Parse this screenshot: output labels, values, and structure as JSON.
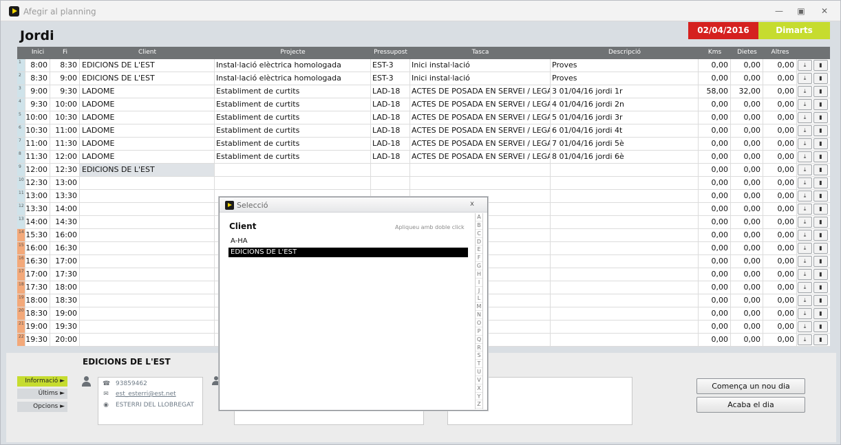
{
  "window": {
    "title": "Afegir al planning"
  },
  "header": {
    "user": "Jordi",
    "date": "02/04/2016",
    "weekday": "Dimarts"
  },
  "columns": [
    "Inici",
    "Fi",
    "Client",
    "Projecte",
    "Pressupost",
    "Tasca",
    "Descripció",
    "Kms",
    "Dietes",
    "Altres"
  ],
  "rows": [
    {
      "n": "1",
      "start": "8:00",
      "end": "8:30",
      "client": "EDICIONS DE L'EST",
      "project": "Instal·lació elèctrica homologada",
      "budget": "EST-3",
      "task": "Inici instal·lació",
      "desc": "Proves",
      "kms": "0,00",
      "dietes": "0,00",
      "altres": "0,00"
    },
    {
      "n": "2",
      "start": "8:30",
      "end": "9:00",
      "client": "EDICIONS DE L'EST",
      "project": "Instal·lació elèctrica homologada",
      "budget": "EST-3",
      "task": "Inici instal·lació",
      "desc": "Proves",
      "kms": "0,00",
      "dietes": "0,00",
      "altres": "0,00"
    },
    {
      "n": "3",
      "start": "9:00",
      "end": "9:30",
      "client": "LADOME",
      "project": "Establiment de curtits",
      "budget": "LAD-18",
      "task": "ACTES DE POSADA EN SERVEI / LEGALIT",
      "desc": "3 01/04/16 jordi 1r",
      "kms": "58,00",
      "dietes": "32,00",
      "altres": "0,00"
    },
    {
      "n": "4",
      "start": "9:30",
      "end": "10:00",
      "client": "LADOME",
      "project": "Establiment de curtits",
      "budget": "LAD-18",
      "task": "ACTES DE POSADA EN SERVEI / LEGALIT",
      "desc": "4 01/04/16 jordi 2n",
      "kms": "0,00",
      "dietes": "0,00",
      "altres": "0,00"
    },
    {
      "n": "5",
      "start": "10:00",
      "end": "10:30",
      "client": "LADOME",
      "project": "Establiment de curtits",
      "budget": "LAD-18",
      "task": "ACTES DE POSADA EN SERVEI / LEGALIT",
      "desc": "5 01/04/16 jordi 3r",
      "kms": "0,00",
      "dietes": "0,00",
      "altres": "0,00"
    },
    {
      "n": "6",
      "start": "10:30",
      "end": "11:00",
      "client": "LADOME",
      "project": "Establiment de curtits",
      "budget": "LAD-18",
      "task": "ACTES DE POSADA EN SERVEI / LEGALIT",
      "desc": "6 01/04/16 jordi 4t",
      "kms": "0,00",
      "dietes": "0,00",
      "altres": "0,00"
    },
    {
      "n": "7",
      "start": "11:00",
      "end": "11:30",
      "client": "LADOME",
      "project": "Establiment de curtits",
      "budget": "LAD-18",
      "task": "ACTES DE POSADA EN SERVEI / LEGALIT",
      "desc": "7 01/04/16 jordi 5è",
      "kms": "0,00",
      "dietes": "0,00",
      "altres": "0,00"
    },
    {
      "n": "8",
      "start": "11:30",
      "end": "12:00",
      "client": "LADOME",
      "project": "Establiment de curtits",
      "budget": "LAD-18",
      "task": "ACTES DE POSADA EN SERVEI / LEGALIT",
      "desc": "8 01/04/16 jordi 6è",
      "kms": "0,00",
      "dietes": "0,00",
      "altres": "0,00"
    },
    {
      "n": "9",
      "start": "12:00",
      "end": "12:30",
      "client": "EDICIONS DE L'EST",
      "project": "",
      "budget": "",
      "task": "",
      "desc": "",
      "kms": "0,00",
      "dietes": "0,00",
      "altres": "0,00",
      "selected": true
    },
    {
      "n": "10",
      "start": "12:30",
      "end": "13:00",
      "client": "",
      "project": "",
      "budget": "",
      "task": "",
      "desc": "",
      "kms": "0,00",
      "dietes": "0,00",
      "altres": "0,00"
    },
    {
      "n": "11",
      "start": "13:00",
      "end": "13:30",
      "client": "",
      "project": "",
      "budget": "",
      "task": "",
      "desc": "",
      "kms": "0,00",
      "dietes": "0,00",
      "altres": "0,00"
    },
    {
      "n": "12",
      "start": "13:30",
      "end": "14:00",
      "client": "",
      "project": "",
      "budget": "",
      "task": "",
      "desc": "",
      "kms": "0,00",
      "dietes": "0,00",
      "altres": "0,00"
    },
    {
      "n": "13",
      "start": "14:00",
      "end": "14:30",
      "client": "",
      "project": "",
      "budget": "",
      "task": "",
      "desc": "",
      "kms": "0,00",
      "dietes": "0,00",
      "altres": "0,00"
    },
    {
      "n": "14",
      "start": "15:30",
      "end": "16:00",
      "client": "",
      "project": "",
      "budget": "",
      "task": "",
      "desc": "",
      "kms": "0,00",
      "dietes": "0,00",
      "altres": "0,00",
      "afternoon": true
    },
    {
      "n": "15",
      "start": "16:00",
      "end": "16:30",
      "client": "",
      "project": "",
      "budget": "",
      "task": "",
      "desc": "",
      "kms": "0,00",
      "dietes": "0,00",
      "altres": "0,00",
      "afternoon": true
    },
    {
      "n": "16",
      "start": "16:30",
      "end": "17:00",
      "client": "",
      "project": "",
      "budget": "",
      "task": "",
      "desc": "",
      "kms": "0,00",
      "dietes": "0,00",
      "altres": "0,00",
      "afternoon": true
    },
    {
      "n": "17",
      "start": "17:00",
      "end": "17:30",
      "client": "",
      "project": "",
      "budget": "",
      "task": "",
      "desc": "",
      "kms": "0,00",
      "dietes": "0,00",
      "altres": "0,00",
      "afternoon": true
    },
    {
      "n": "18",
      "start": "17:30",
      "end": "18:00",
      "client": "",
      "project": "",
      "budget": "",
      "task": "",
      "desc": "",
      "kms": "0,00",
      "dietes": "0,00",
      "altres": "0,00",
      "afternoon": true
    },
    {
      "n": "19",
      "start": "18:00",
      "end": "18:30",
      "client": "",
      "project": "",
      "budget": "",
      "task": "",
      "desc": "",
      "kms": "0,00",
      "dietes": "0,00",
      "altres": "0,00",
      "afternoon": true
    },
    {
      "n": "20",
      "start": "18:30",
      "end": "19:00",
      "client": "",
      "project": "",
      "budget": "",
      "task": "",
      "desc": "",
      "kms": "0,00",
      "dietes": "0,00",
      "altres": "0,00",
      "afternoon": true
    },
    {
      "n": "21",
      "start": "19:00",
      "end": "19:30",
      "client": "",
      "project": "",
      "budget": "",
      "task": "",
      "desc": "",
      "kms": "0,00",
      "dietes": "0,00",
      "altres": "0,00",
      "afternoon": true
    },
    {
      "n": "22",
      "start": "19:30",
      "end": "20:00",
      "client": "",
      "project": "",
      "budget": "",
      "task": "",
      "desc": "",
      "kms": "0,00",
      "dietes": "0,00",
      "altres": "0,00",
      "afternoon": true
    }
  ],
  "colors": {
    "morning_marker": "#cfe3ea",
    "afternoon_marker": "#f3a97a",
    "date_bg": "#d5211f",
    "weekday_bg": "#c6dc2f"
  },
  "bottom": {
    "client_name": "EDICIONS DE L'EST",
    "tabs": {
      "info": "Informació ►",
      "last": "Últims ►",
      "options": "Opcions ►"
    },
    "phone": "93859462",
    "email": "est_esterri@est.net",
    "location": "ESTERRI DEL LLOBREGAT",
    "start_day": "Comença un nou dia",
    "end_day": "Acaba el dia"
  },
  "dialog": {
    "title": "Selecció",
    "close": "x",
    "label": "Client",
    "hint": "Apliqueu amb doble click",
    "items": [
      "A-HA",
      "EDICIONS DE L'EST"
    ],
    "selected_index": 1,
    "alphabet": [
      "A",
      "B",
      "C",
      "D",
      "E",
      "F",
      "G",
      "H",
      "I",
      "J",
      "L",
      "M",
      "N",
      "O",
      "P",
      "Q",
      "R",
      "S",
      "T",
      "U",
      "V",
      "X",
      "Y",
      "Z"
    ]
  }
}
